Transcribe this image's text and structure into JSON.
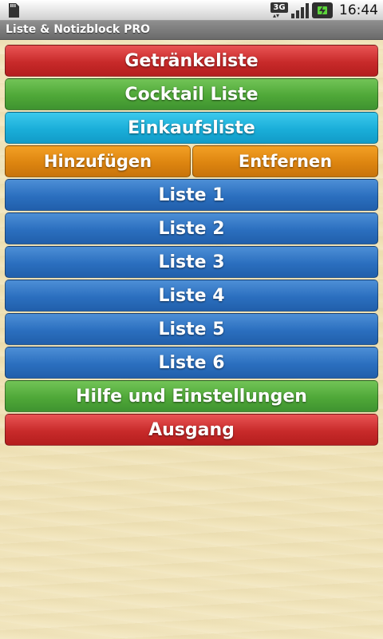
{
  "status_bar": {
    "left_icon": "sd-card-icon",
    "network_label": "3G",
    "time": "16:44"
  },
  "app": {
    "title": "Liste & Notizblock PRO"
  },
  "buttons": {
    "getraenkeliste": "Getränkeliste",
    "cocktail_liste": "Cocktail Liste",
    "einkaufsliste": "Einkaufsliste",
    "hinzufuegen": "Hinzufügen",
    "entfernen": "Entfernen",
    "liste1": "Liste 1",
    "liste2": "Liste 2",
    "liste3": "Liste 3",
    "liste4": "Liste 4",
    "liste5": "Liste 5",
    "liste6": "Liste 6",
    "hilfe": "Hilfe und Einstellungen",
    "ausgang": "Ausgang"
  },
  "colors": {
    "red": "#c82a2a",
    "green": "#4fa838",
    "cyan": "#1aaed9",
    "orange": "#dd8510",
    "blue": "#2b6fbf",
    "background": "#f0e3b8"
  }
}
